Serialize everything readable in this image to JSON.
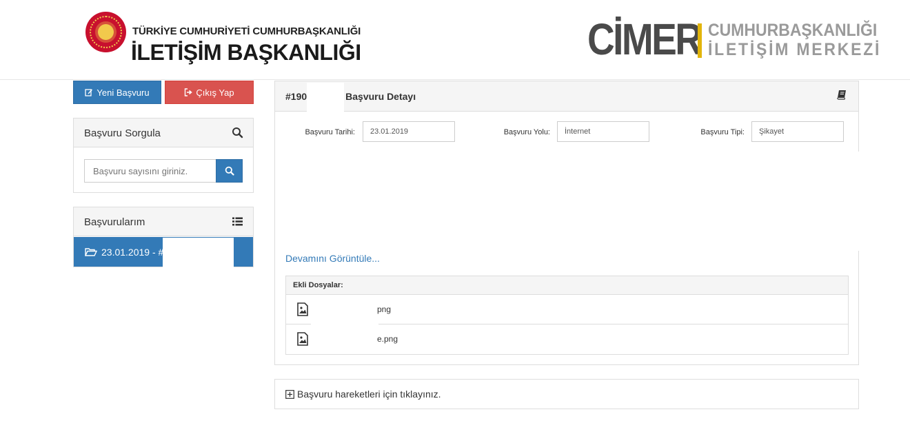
{
  "header": {
    "institution_top": "TÜRKİYE CUMHURİYETİ CUMHURBAŞKANLIĞI",
    "institution_main": "İLETİŞİM BAŞKANLIĞI",
    "brand_word": "CİMER",
    "brand_sub1": "CUMHURBAŞKANLIĞI",
    "brand_sub2": "İLETİŞİM MERKEZİ"
  },
  "sidebar": {
    "new_button": "Yeni Başvuru",
    "exit_button": "Çıkış Yap",
    "query_panel": {
      "title": "Başvuru Sorgula",
      "placeholder": "Başvuru sayısını giriniz."
    },
    "applications_panel": {
      "title": "Başvurularım",
      "items": [
        {
          "label": "23.01.2019 - #19"
        }
      ]
    }
  },
  "detail": {
    "title_prefix": "#190",
    "title_suffix": "Başvuru Detayı",
    "fields": [
      {
        "label": "Başvuru Tarihi:",
        "value": "23.01.2019"
      },
      {
        "label": "Başvuru Yolu:",
        "value": "İnternet"
      },
      {
        "label": "Başvuru Tipi:",
        "value": "Şikayet"
      }
    ],
    "show_more": "Devamını Görüntüle...",
    "attachments": {
      "title": "Ekli Dosyalar:",
      "files": [
        {
          "name": "png"
        },
        {
          "name": "e.png"
        }
      ]
    }
  },
  "history": {
    "label": "Başvuru hareketleri için tıklayınız."
  },
  "colors": {
    "primary": "#337ab7",
    "danger": "#d9534f",
    "brand_accent": "#e2b50b",
    "seal_red": "#c8102e"
  },
  "icons": [
    "edit-icon",
    "sign-out-icon",
    "search-icon",
    "list-icon",
    "folder-open-icon",
    "book-icon",
    "image-file-icon",
    "plus-square-icon"
  ]
}
